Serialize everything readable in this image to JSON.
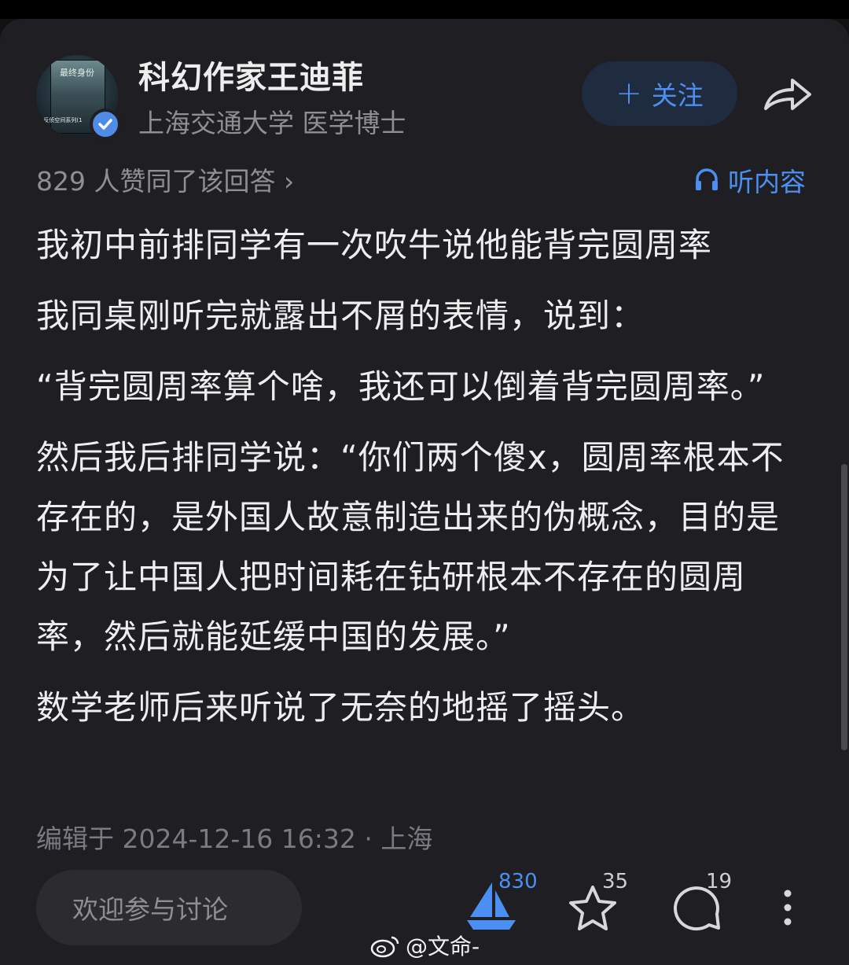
{
  "author": {
    "name": "科幻作家王迪菲",
    "description": "上海交通大学 医学博士",
    "avatar_book_title": "最终身份",
    "avatar_book_footer": "反侦空间系列(1"
  },
  "follow": {
    "label": "关注",
    "icon": "plus-icon"
  },
  "share": {
    "icon": "share-arrow-icon"
  },
  "meta": {
    "likes_text": "829 人赞同了该回答 ›",
    "listen_label": "听内容"
  },
  "content": {
    "paragraphs": [
      "我初中前排同学有一次吹牛说他能背完圆周率",
      "我同桌刚听完就露出不屑的表情，说到：",
      "“背完圆周率算个啥，我还可以倒着背完圆周率。”",
      "然后我后排同学说：“你们两个傻x，圆周率根本不存在的，是外国人故意制造出来的伪概念，目的是为了让中国人把时间耗在钻研根本不存在的圆周率，然后就能延缓中国的发展。”",
      "数学老师后来听说了无奈的地摇了摇头。"
    ]
  },
  "edit_info": "编辑于 2024-12-16 16:32 · 上海",
  "bottom": {
    "comment_placeholder": "欢迎参与讨论",
    "upvote_count": "830",
    "favorite_count": "35",
    "comment_count": "19"
  },
  "watermark": "@文命-",
  "colors": {
    "background": "#1f1f23",
    "accent": "#4c8ff2",
    "text_primary": "#eeeeee",
    "text_secondary": "#8e8e93"
  }
}
